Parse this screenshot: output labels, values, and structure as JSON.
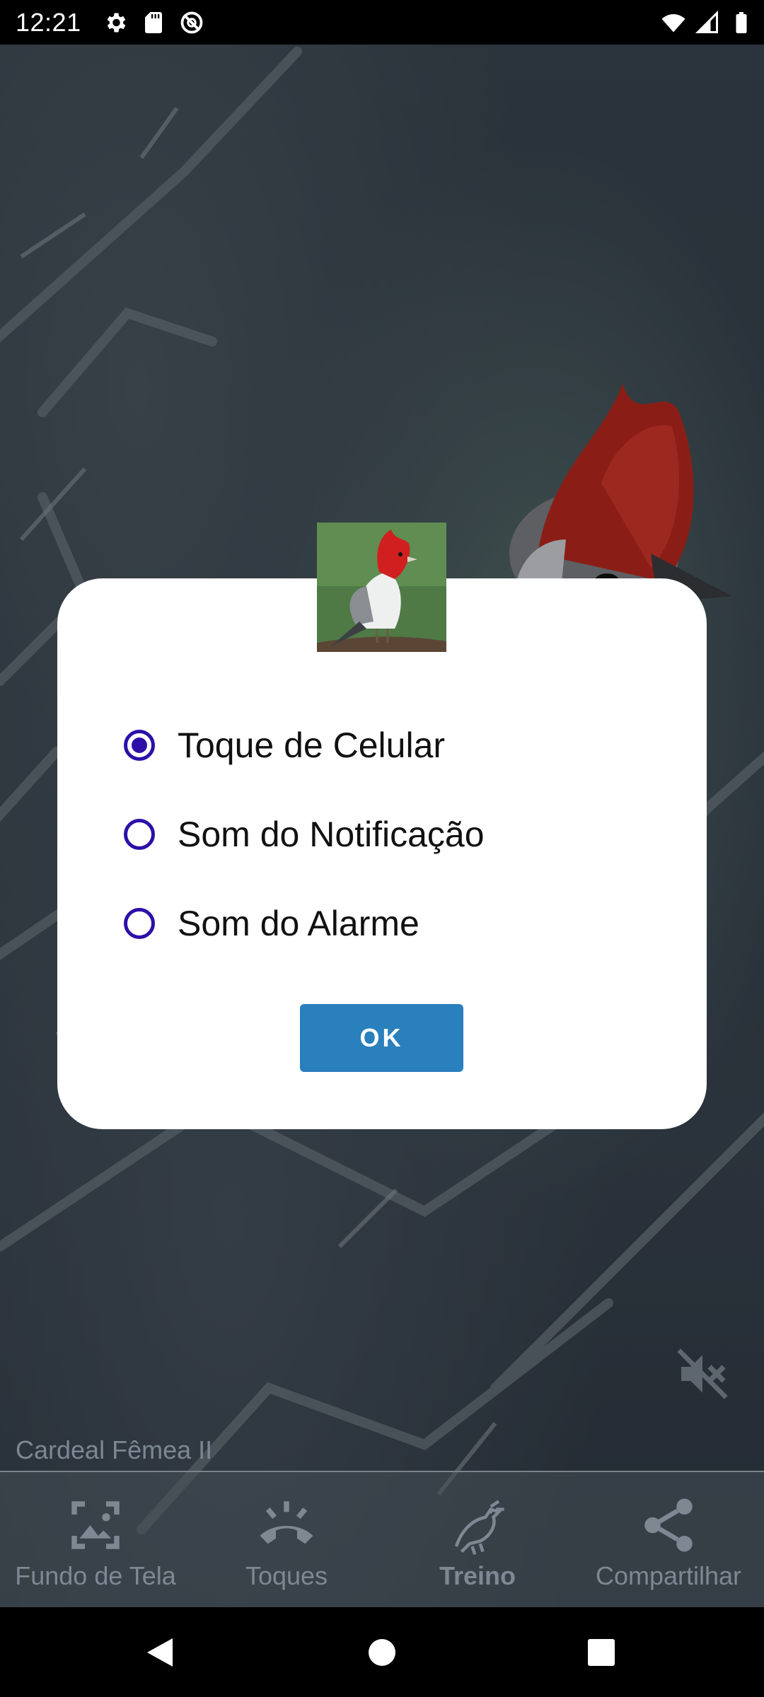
{
  "status_bar": {
    "time": "12:21",
    "left_icons": [
      "gear-icon",
      "sd-card-icon",
      "data-saver-icon"
    ],
    "right_icons": [
      "wifi-icon",
      "signal-icon",
      "battery-icon"
    ]
  },
  "background": {
    "caption": "Cardeal Fêmea II"
  },
  "dialog": {
    "options": [
      {
        "label": "Toque de Celular",
        "selected": true
      },
      {
        "label": "Som do Notificação",
        "selected": false
      },
      {
        "label": "Som do Alarme",
        "selected": false
      }
    ],
    "ok_label": "OK",
    "accent_color": "#2d0fa8",
    "button_color": "#2a7fbd"
  },
  "bottom_nav": {
    "items": [
      {
        "label": "Fundo de Tela",
        "icon": "wallpaper-icon"
      },
      {
        "label": "Toques",
        "icon": "ringtone-icon"
      },
      {
        "label": "Treino",
        "icon": "bird-icon",
        "active": true
      },
      {
        "label": "Compartilhar",
        "icon": "share-icon"
      }
    ]
  }
}
